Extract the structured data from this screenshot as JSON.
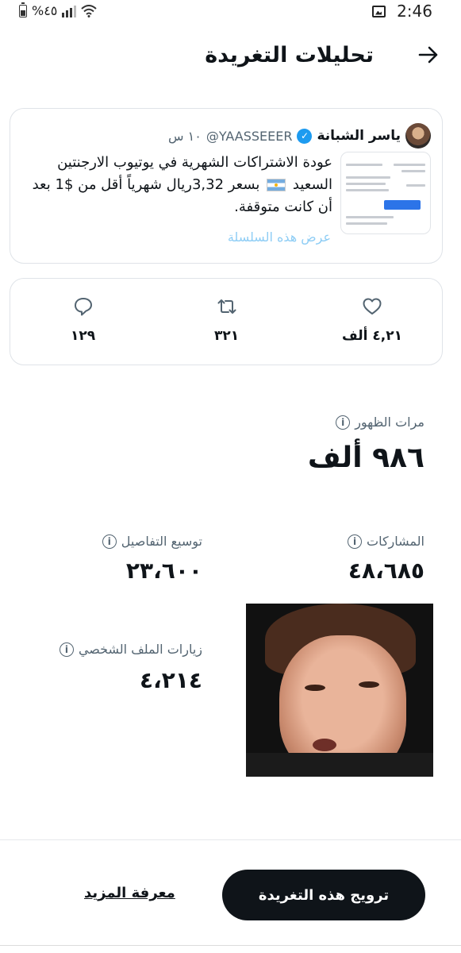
{
  "status_bar": {
    "battery_percent": "%٤٥",
    "time": "2:46"
  },
  "header": {
    "title": "تحليلات التغريدة"
  },
  "tweet": {
    "display_name": "ياسر الشبانة",
    "handle": "@YAASSEEER",
    "time": "١٠ س",
    "text_part1": "عودة الاشتراكات الشهرية في يوتيوب الارجنتين السعيد",
    "text_part2": "بسعر 3,32ريال شهرياً أقل من $1 بعد أن كانت متوقفة.",
    "show_thread": "عرض هذه السلسلة"
  },
  "engagement": {
    "likes": "٤,٢١ ألف",
    "retweets": "٣٢١",
    "replies": "١٢٩"
  },
  "metrics": {
    "impressions_label": "مرات الظهور",
    "impressions_value": "٩٨٦ ألف",
    "engagements_label": "المشاركات",
    "engagements_value": "٤٨،٦٨٥",
    "detail_expands_label": "توسيع التفاصيل",
    "detail_expands_value": "٢٣،٦٠٠",
    "profile_visits_label": "زيارات الملف الشخصي",
    "profile_visits_value": "٤،٢١٤"
  },
  "actions": {
    "promote_label": "ترويج هذه التغريدة",
    "learn_more_label": "معرفة المزيد"
  },
  "colors": {
    "accent": "#1d9bf0",
    "text_primary": "#0f1419",
    "text_secondary": "#536471",
    "link_muted": "#8ecdf5"
  }
}
